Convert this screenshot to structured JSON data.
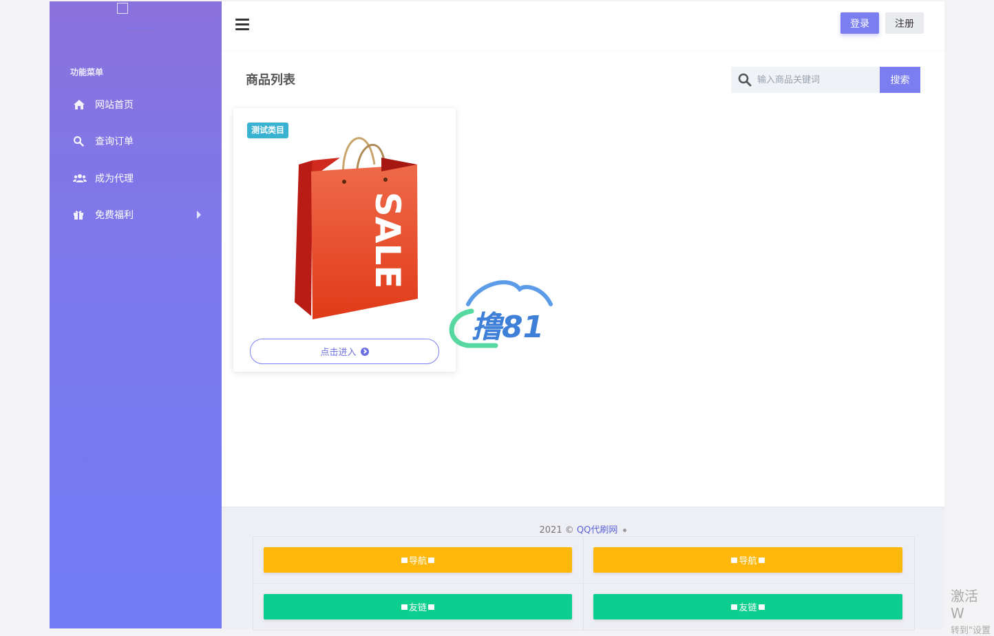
{
  "sidebar": {
    "menu_title": "功能菜单",
    "items": [
      {
        "label": "网站首页",
        "icon": "home-icon"
      },
      {
        "label": "查询订单",
        "icon": "search-icon"
      },
      {
        "label": "成为代理",
        "icon": "users-icon"
      },
      {
        "label": "免费福利",
        "icon": "gift-icon",
        "has_submenu": true
      }
    ]
  },
  "header": {
    "login_label": "登录",
    "register_label": "注册"
  },
  "main": {
    "section_title": "商品列表",
    "search": {
      "placeholder": "输入商品关键词",
      "button_label": "搜索"
    },
    "products": [
      {
        "badge": "测试类目",
        "image": "sale-bag",
        "bag_text": "SALE",
        "enter_label": "点击进入"
      }
    ]
  },
  "watermark": {
    "text": "撸81"
  },
  "footer": {
    "copyright_prefix": "2021 ©",
    "site_name": "QQ代刷网",
    "links": [
      {
        "label": "导航",
        "color": "#ffb80a"
      },
      {
        "label": "导航",
        "color": "#ffb80a"
      },
      {
        "label": "友链",
        "color": "#0ccf8f"
      },
      {
        "label": "友链",
        "color": "#0ccf8f"
      }
    ]
  },
  "os_overlay": {
    "line1": "激活 W",
    "line2": "转到\"设置"
  },
  "colors": {
    "accent": "#7b7ef0",
    "badge": "#39b2d1"
  }
}
